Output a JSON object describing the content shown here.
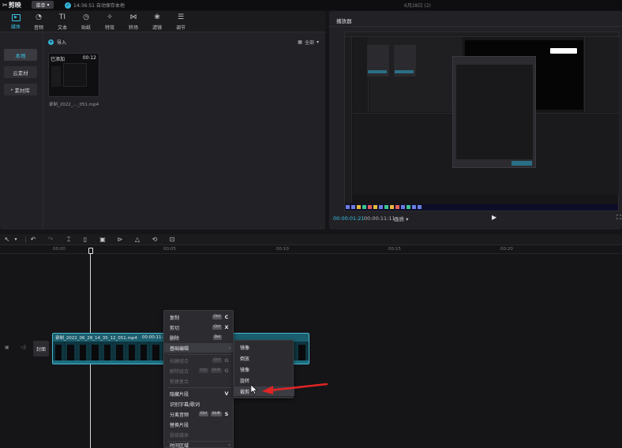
{
  "titlebar": {
    "app_name": "剪映",
    "menu_label": "菜单",
    "save_status": "14:36:51 自动保存本地",
    "project_title": "6月28日 (2)"
  },
  "media_toolbar": {
    "tabs": [
      {
        "label": "媒体",
        "icon": "media-icon"
      },
      {
        "label": "音频",
        "icon": "audio-icon"
      },
      {
        "label": "文本",
        "icon": "text-icon"
      },
      {
        "label": "贴纸",
        "icon": "sticker-icon"
      },
      {
        "label": "特效",
        "icon": "effects-icon"
      },
      {
        "label": "转场",
        "icon": "transition-icon"
      },
      {
        "label": "滤镜",
        "icon": "filter-icon"
      },
      {
        "label": "调节",
        "icon": "adjust-icon"
      }
    ],
    "active_tab": 0,
    "accent_color": "#38c3e6"
  },
  "sidebar": {
    "items": [
      {
        "label": "本地"
      },
      {
        "label": "云素材"
      },
      {
        "label": "素材库"
      }
    ]
  },
  "media_pane": {
    "import_label": "导入",
    "sort_label": "全部",
    "card": {
      "added_label": "已添加",
      "duration": "00:12",
      "file_name": "录制_2022_..._051.mp4"
    }
  },
  "preview": {
    "title": "播放器",
    "current_time": "00:00:01:21",
    "total_time": "00:00:11:11",
    "quality": "画质"
  },
  "timeline": {
    "ruler_labels": [
      "00:00",
      "00:05",
      "00:10",
      "00:15",
      "00:20"
    ],
    "cover_label": "封面",
    "clip": {
      "name": "录制_2022_06_28_14_35_12_051.mp4",
      "duration": "00:00:11:11"
    }
  },
  "context_menu": {
    "items": [
      {
        "label": "复制",
        "keys": [
          "Ctrl"
        ],
        "letter": "C",
        "disabled": false
      },
      {
        "label": "剪切",
        "keys": [
          "Ctrl"
        ],
        "letter": "X",
        "disabled": false
      },
      {
        "label": "删除",
        "keys": [
          "Del"
        ],
        "letter": "",
        "disabled": false
      },
      {
        "label": "基础编辑",
        "keys": [],
        "letter": "",
        "disabled": false,
        "submenu": true
      },
      {
        "label": "创建组合",
        "keys": [
          "Ctrl"
        ],
        "letter": "G",
        "disabled": true
      },
      {
        "label": "解除组合",
        "keys": [
          "Ctrl",
          "Shift"
        ],
        "letter": "G",
        "disabled": true
      },
      {
        "label": "新建复合",
        "keys": [],
        "letter": "",
        "disabled": true
      },
      {
        "label": "隐藏片段",
        "keys": [],
        "letter": "V",
        "disabled": false
      },
      {
        "label": "识别字幕/歌词",
        "keys": [],
        "letter": "",
        "disabled": false
      },
      {
        "label": "分离音频",
        "keys": [
          "Ctrl",
          "Shift"
        ],
        "letter": "S",
        "disabled": false
      },
      {
        "label": "替换片段",
        "keys": [],
        "letter": "",
        "disabled": false
      },
      {
        "label": "链接媒体",
        "keys": [],
        "letter": "",
        "disabled": true
      },
      {
        "label": "时间区域",
        "keys": [],
        "letter": "",
        "disabled": false,
        "submenu": true
      }
    ]
  },
  "submenu": {
    "items": [
      {
        "label": "镜像"
      },
      {
        "label": "倒放"
      },
      {
        "label": "镜像"
      },
      {
        "label": "旋转"
      },
      {
        "label": "裁剪"
      }
    ],
    "highlighted": 4
  },
  "annotation": {
    "arrow_color": "#e02424"
  }
}
